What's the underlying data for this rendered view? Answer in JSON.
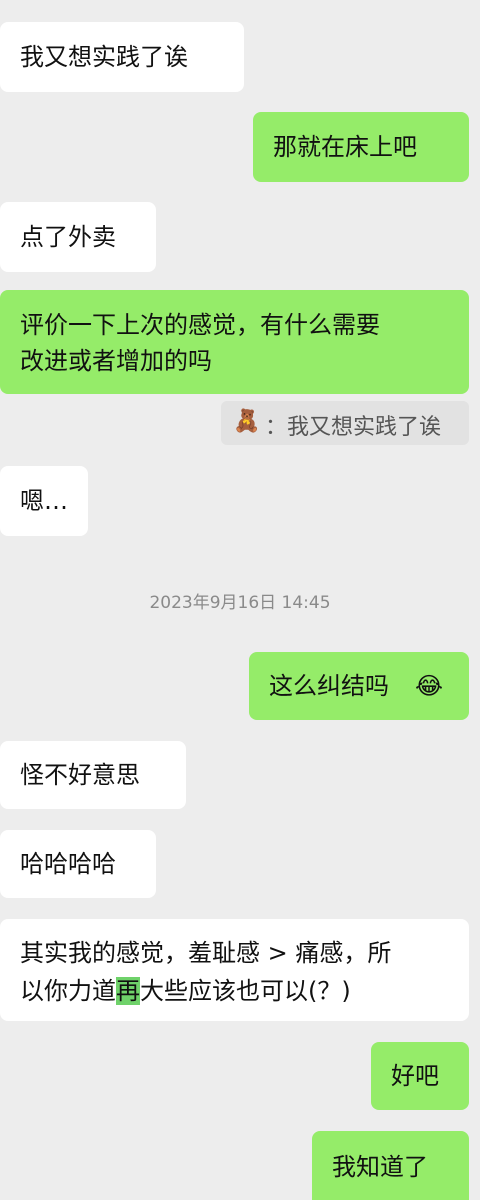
{
  "messages": [
    {
      "text": "我又想实践了诶"
    },
    {
      "text": "那就在床上吧"
    },
    {
      "text": "点了外卖"
    },
    {
      "line1": "评价一下上次的感觉，有什么需要",
      "line2": "改进或者增加的吗"
    },
    {
      "quote_icon": "🧸",
      "quote_text": "：我又想实践了诶"
    },
    {
      "text": "嗯…"
    },
    {
      "timestamp": "2023年9月16日 14:45"
    },
    {
      "text": "这么纠结吗",
      "emoji": "😂"
    },
    {
      "text": "怪不好意思"
    },
    {
      "text": "哈哈哈哈"
    },
    {
      "line1": "其实我的感觉，羞耻感 > 痛感，所",
      "line2_pre": "以你力道",
      "line2_hl": "再",
      "line2_post": "大些应该也可以(？)"
    },
    {
      "text": "好吧"
    },
    {
      "text": "我知道了"
    }
  ]
}
